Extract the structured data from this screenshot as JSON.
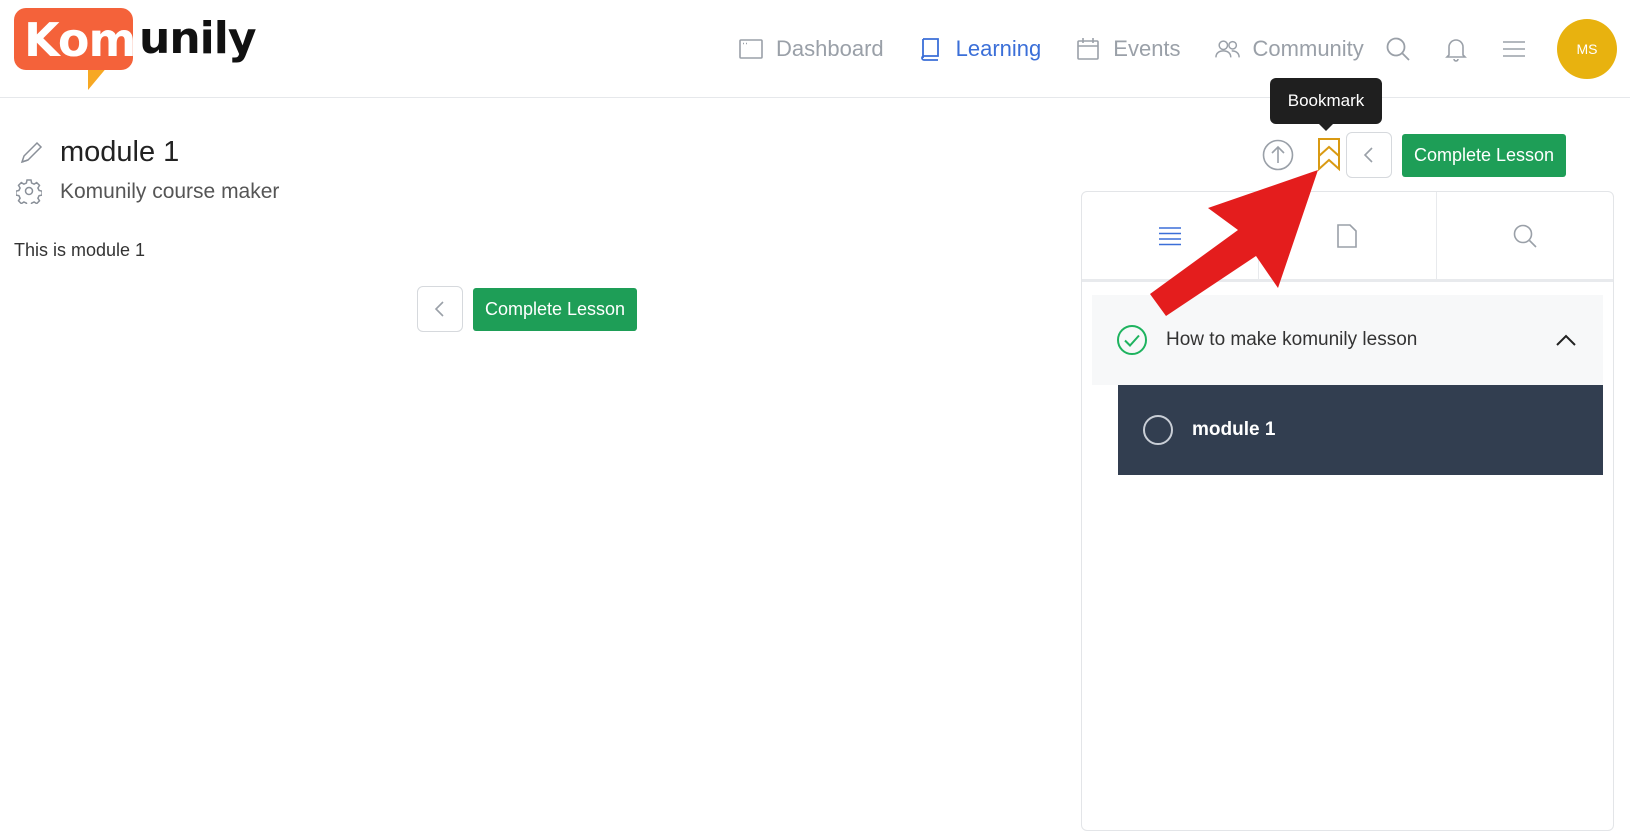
{
  "brand": {
    "kom": "Kom",
    "unily": "unily"
  },
  "nav": {
    "items": [
      {
        "label": "Dashboard",
        "icon": "browser-window-icon"
      },
      {
        "label": "Learning",
        "icon": "book-icon"
      },
      {
        "label": "Events",
        "icon": "calendar-icon"
      },
      {
        "label": "Community",
        "icon": "users-icon"
      }
    ],
    "active": "Learning",
    "avatar_initials": "MS"
  },
  "page": {
    "title": "module 1",
    "subtitle": "Komunily course maker",
    "content": "This is module 1"
  },
  "actions": {
    "complete_label": "Complete Lesson",
    "tooltip": "Bookmark"
  },
  "sidebar": {
    "tabs": [
      "list-icon",
      "document-icon",
      "search-icon"
    ],
    "section": {
      "label": "How to make komunily lesson",
      "completed": true
    },
    "lessons": [
      {
        "label": "module 1",
        "current": true
      }
    ]
  },
  "colors": {
    "brand_orange": "#f4623a",
    "brand_yellow": "#f7a823",
    "accent_blue": "#3b6fd8",
    "success_green": "#1e9e57",
    "avatar": "#e8b20f",
    "bookmark": "#d99a13",
    "active_lesson_bg": "#323e50",
    "annotation_red": "#e41d1d"
  }
}
